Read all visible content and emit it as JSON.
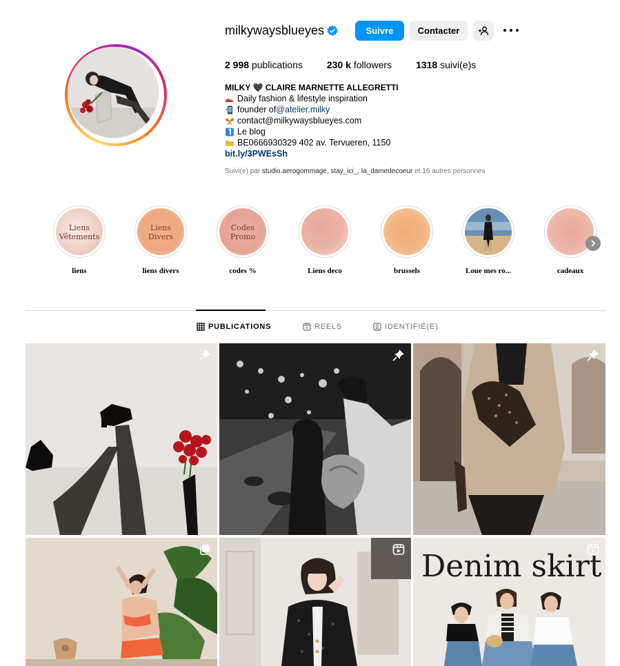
{
  "profile": {
    "username": "milkywaysblueyes",
    "follow_label": "Suivre",
    "contact_label": "Contacter",
    "verified": true,
    "stats": {
      "posts_count": "2 998",
      "posts_label": "publications",
      "followers_count": "230 k",
      "followers_label": "followers",
      "following_count": "1318",
      "following_label": "suivi(e)s"
    },
    "bio": {
      "name": "MILKY 🖤 CLAIRE MARNETTE ALLEGRETTI",
      "line1": "Daily fashion & lifestyle inspiration",
      "line2_prefix": "founder of ",
      "line2_mention": "@atelier.milky",
      "line3": "contact@milkywaysblueyes.com",
      "line4": "Le blog",
      "line5": "BE0666930329 402 av. Tervueren, 1150",
      "url": "bit.ly/3PWEsSh"
    },
    "followed_by": {
      "prefix": "Suivi(e) par",
      "names": "studio.aerogommage, stay_ici_, la_damedecoeur",
      "suffix": "et 16 autres personnes"
    }
  },
  "highlights": [
    {
      "label": "liens",
      "cover_text": "Liens Vêtements"
    },
    {
      "label": "liens divers",
      "cover_text": "Liens Divers"
    },
    {
      "label": "codes %",
      "cover_text": "Codes Promo"
    },
    {
      "label": "Liens deco",
      "cover_text": ""
    },
    {
      "label": "brussels",
      "cover_text": ""
    },
    {
      "label": "Loue mes ro...",
      "cover_text": ""
    },
    {
      "label": "cadeaux",
      "cover_text": ""
    }
  ],
  "tabs": [
    {
      "label": "PUBLICATIONS",
      "active": true,
      "icon": "grid-icon"
    },
    {
      "label": "REELS",
      "active": false,
      "icon": "reels-icon"
    },
    {
      "label": "IDENTIFIÉ(E)",
      "active": false,
      "icon": "tagged-icon"
    }
  ],
  "posts": [
    {
      "badge": "pin-icon"
    },
    {
      "badge": "pin-icon"
    },
    {
      "badge": "pin-icon"
    },
    {
      "badge": "carousel-icon"
    },
    {
      "badge": "reel-icon"
    },
    {
      "badge": "reel-icon",
      "overlay_text": "Denim skirt"
    }
  ],
  "colors": {
    "accent": "#0095f6",
    "secondary_button": "#efefef",
    "link": "#00376b",
    "muted": "#737373"
  }
}
